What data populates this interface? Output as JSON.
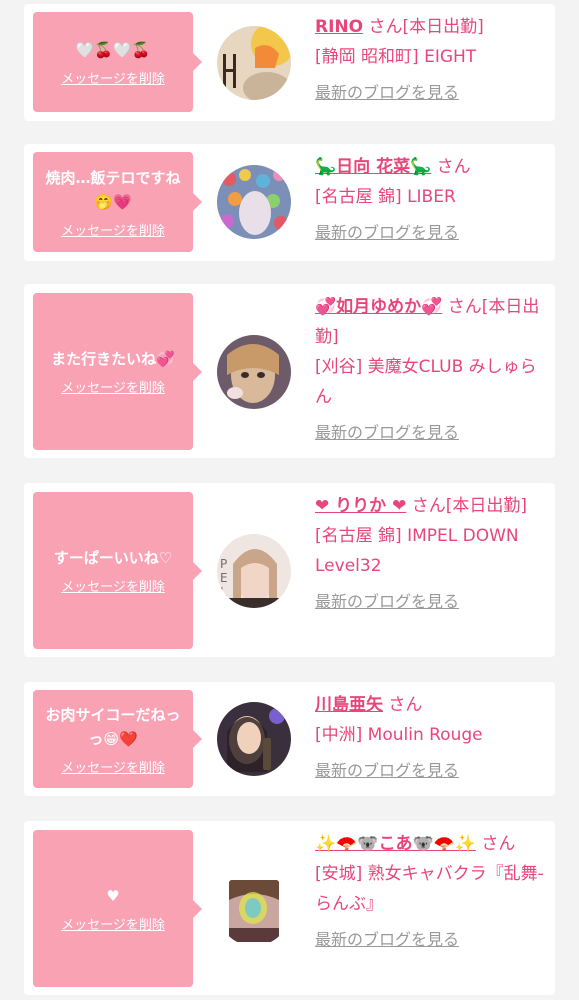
{
  "delete_label": "メッセージを削除",
  "blog_label": "最新のブログを見る",
  "san_label": "さん",
  "colors": {
    "bubble": "#f9a2b4",
    "accent": "#e8467a",
    "link_gray": "#999999",
    "background": "#f3f3f3"
  },
  "cards": [
    {
      "message": "🤍🍒🤍🍒",
      "cast_name": "RINO",
      "suffix": "さん[本日出勤]",
      "shop": "[静岡 昭和町] EIGHT"
    },
    {
      "message": "焼肉…飯テロですね🤭💗",
      "cast_name": "🦕日向 花菜🦕",
      "suffix": "さん",
      "shop": "[名古屋 錦] LIBER"
    },
    {
      "message": "また行きたいね💞",
      "cast_name": "💞如月ゆめか💞",
      "suffix": "さん[本日出勤]",
      "shop": "[刈谷] 美魔女CLUB みしゅらん"
    },
    {
      "message": "すーぱーいいね♡",
      "cast_name": "❤ りりか ❤",
      "suffix": "さん[本日出勤]",
      "shop": "[名古屋 錦] IMPEL DOWN Level32"
    },
    {
      "message": "お肉サイコーだねっっ😁❤️",
      "cast_name": "川島亜矢",
      "suffix": "さん",
      "shop": "[中洲] Moulin Rouge"
    },
    {
      "message": "♥",
      "cast_name": "✨🪭🐨こあ🐨🪭✨",
      "suffix": "さん",
      "shop": "[安城] 熟女キャバクラ『乱舞-らんぶ』"
    }
  ]
}
